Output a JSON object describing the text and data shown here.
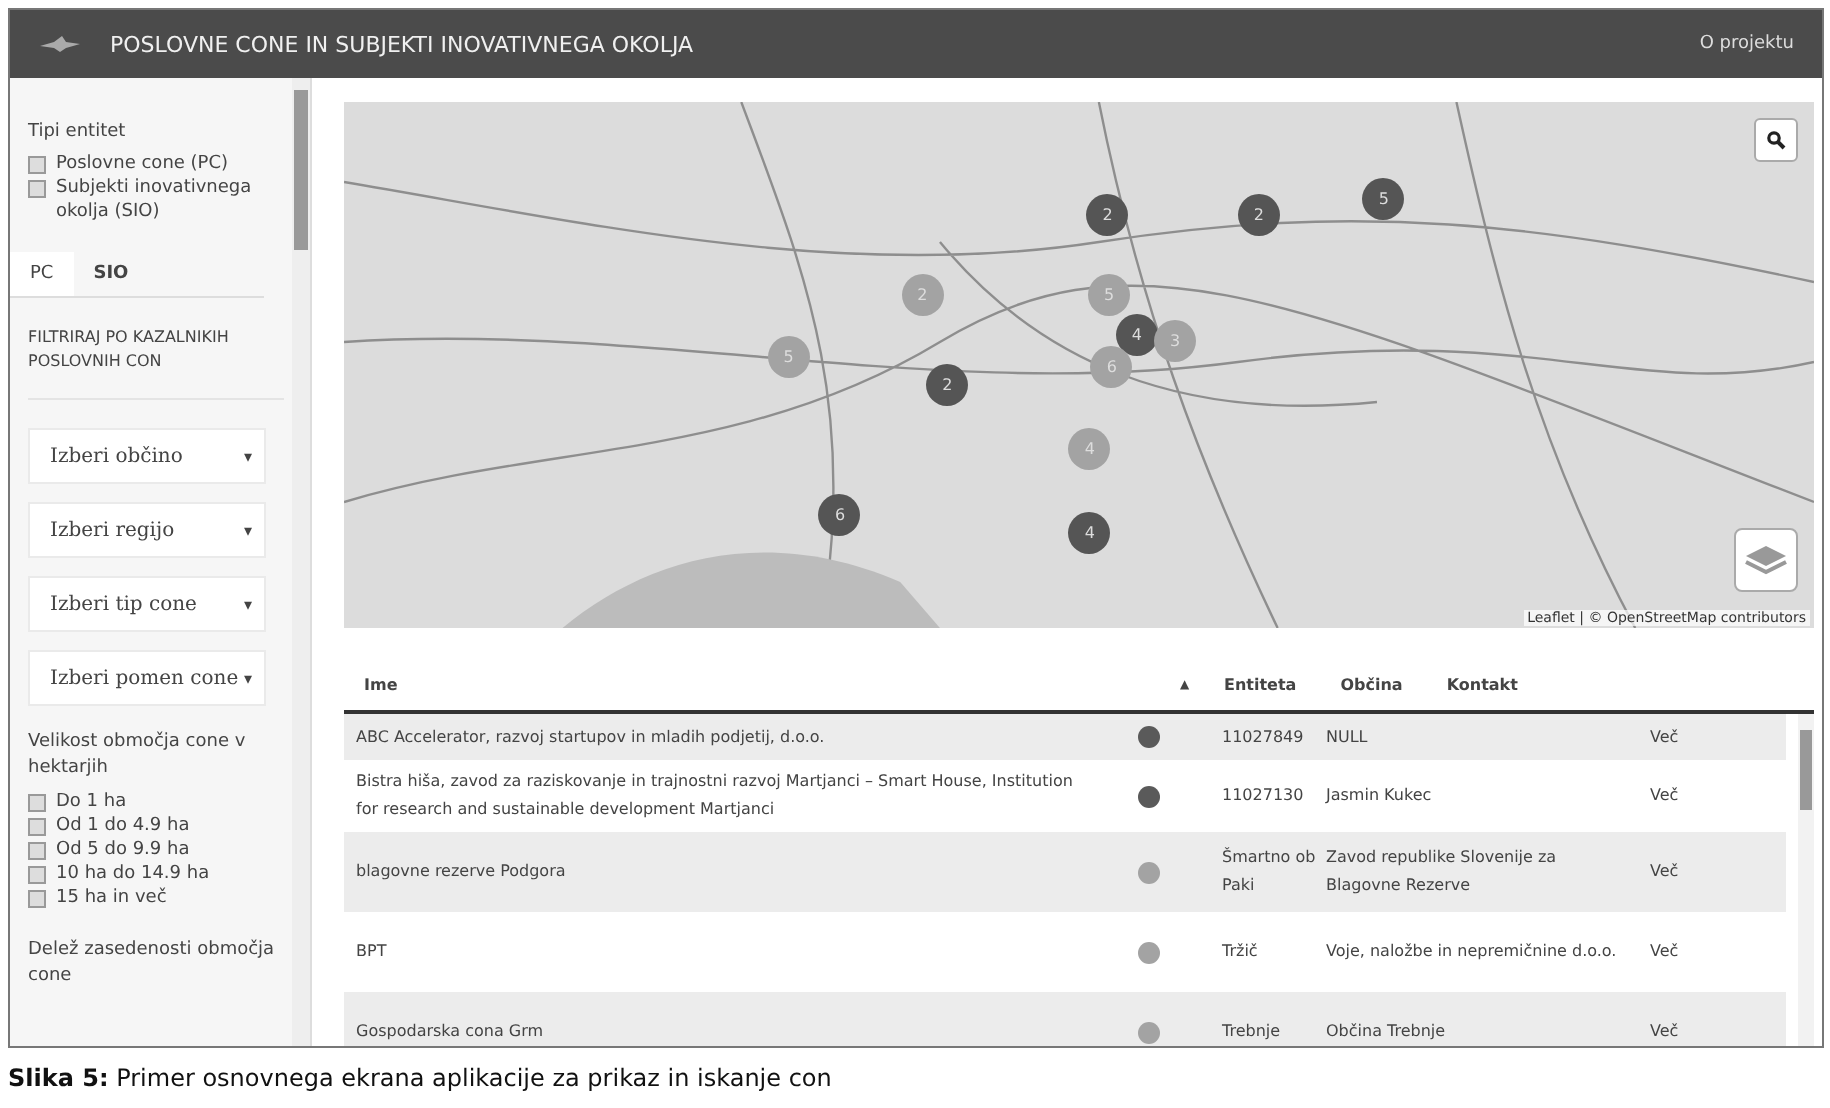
{
  "header": {
    "title": "POSLOVNE CONE IN SUBJEKTI INOVATIVNEGA OKOLJA",
    "link": "O projektu"
  },
  "sidebar": {
    "entity_heading": "Tipi entitet",
    "entity_types": [
      {
        "label": "Poslovne cone (PC)",
        "checked": false
      },
      {
        "label": "Subjekti inovativnega okolja (SIO)",
        "checked": false
      }
    ],
    "tabs": [
      {
        "label": "PC",
        "selected": true
      },
      {
        "label": "SIO",
        "selected": false
      }
    ],
    "filter_heading": "FILTRIRAJ PO KAZALNIKIH POSLOVNIH CON",
    "dropdowns": [
      {
        "value": "Izberi občino",
        "caret": "▾"
      },
      {
        "value": "Izberi regijo",
        "caret": "▾"
      },
      {
        "value": "Izberi tip cone",
        "caret": "▾"
      },
      {
        "value": "Izberi pomen cone",
        "caret": "▾"
      }
    ],
    "size_heading": "Velikost območja cone v hektarjih",
    "sizes": [
      {
        "label": "Do 1 ha",
        "checked": false
      },
      {
        "label": "Od 1 do 4.9 ha",
        "checked": false
      },
      {
        "label": "Od 5 do 9.9 ha",
        "checked": false
      },
      {
        "label": "10 ha do 14.9 ha",
        "checked": false
      },
      {
        "label": "15 ha in več",
        "checked": false
      }
    ],
    "occupancy_heading": "Delež zasedenosti območja cone"
  },
  "map": {
    "attribution": "Leaflet | © OpenStreetMap contributors",
    "markers": [
      {
        "count": "2",
        "color": "#555555"
      },
      {
        "count": "2",
        "color": "#555555"
      },
      {
        "count": "5",
        "color": "#555555"
      },
      {
        "count": "2",
        "color": "#a3a3a3"
      },
      {
        "count": "5",
        "color": "#a3a3a3"
      },
      {
        "count": "4",
        "color": "#555555"
      },
      {
        "count": "3",
        "color": "#a3a3a3"
      },
      {
        "count": "6",
        "color": "#a3a3a3"
      },
      {
        "count": "5",
        "color": "#a3a3a3"
      },
      {
        "count": "2",
        "color": "#555555"
      },
      {
        "count": "4",
        "color": "#a3a3a3"
      },
      {
        "count": "6",
        "color": "#555555"
      },
      {
        "count": "4",
        "color": "#555555"
      }
    ]
  },
  "table": {
    "columns": [
      "Ime",
      "Entiteta",
      "Občina",
      "Kontakt"
    ],
    "sort_mark": "▲",
    "rows": [
      {
        "name": "ABC Accelerator, razvoj startupov in mladih podjetij, d.o.o.",
        "color": "#5a5a5a",
        "column_3": "11027849",
        "column_4": "NULL",
        "link": "Več"
      },
      {
        "name": "Bistra hiša, zavod za raziskovanje in trajnostni razvoj Martjanci – Smart House, Institution for research and sustainable development Martjanci",
        "color": "#5a5a5a",
        "column_3": "11027130",
        "column_4": "Jasmin Kukec",
        "link": "Več"
      },
      {
        "name": "blagovne rezerve Podgora",
        "color": "#a3a3a3",
        "column_3": "Šmartno ob Paki",
        "column_4": "Zavod republike Slovenije za Blagovne Rezerve",
        "link": "Več"
      },
      {
        "name": "BPT",
        "color": "#a3a3a3",
        "column_3": "Tržič",
        "column_4": "Voje, naložbe in nepremičnine d.o.o.",
        "link": "Več"
      },
      {
        "name": "Gospodarska cona Grm",
        "color": "#a3a3a3",
        "column_3": "Trebnje",
        "column_4": "Občina Trebnje",
        "link": "Več"
      }
    ]
  },
  "caption": "**Slika 5:** Primer osnovnega ekrana aplikacije za prikaz in iskanje con"
}
